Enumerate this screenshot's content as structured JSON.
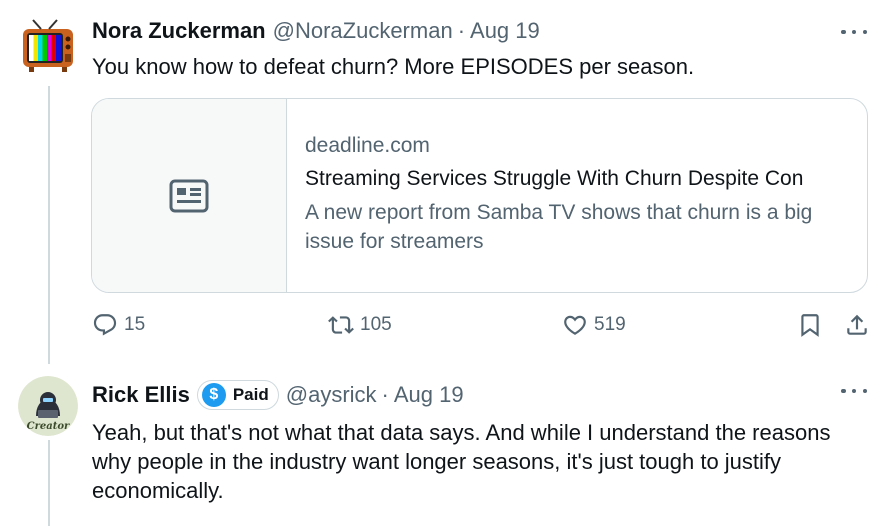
{
  "tweet1": {
    "name": "Nora Zuckerman",
    "handle": "@NoraZuckerman",
    "separator": "·",
    "date": "Aug 19",
    "avatar_icon": "tv-icon",
    "text": "You know how to defeat churn?  More EPISODES per season.",
    "card": {
      "icon": "newspaper-icon",
      "domain": "deadline.com",
      "title": "Streaming Services Struggle With Churn Despite Con",
      "description": "A new report from Samba TV shows that churn is a big issue for streamers"
    },
    "actions": {
      "replies": "15",
      "retweets": "105",
      "likes": "519"
    }
  },
  "tweet2": {
    "name": "Rick Ellis",
    "badge_label": "Paid",
    "badge_symbol": "$",
    "handle": "@aysrick",
    "separator": "·",
    "date": "Aug 19",
    "avatar_label": "Creator",
    "text": "Yeah, but that's not what that data says. And while I understand the reasons why people in the industry want longer seasons, it's just tough to justify economically."
  },
  "colors": {
    "text": "#0f1419",
    "secondary": "#536471",
    "border": "#cfd9de",
    "accent": "#1d9bf0"
  }
}
